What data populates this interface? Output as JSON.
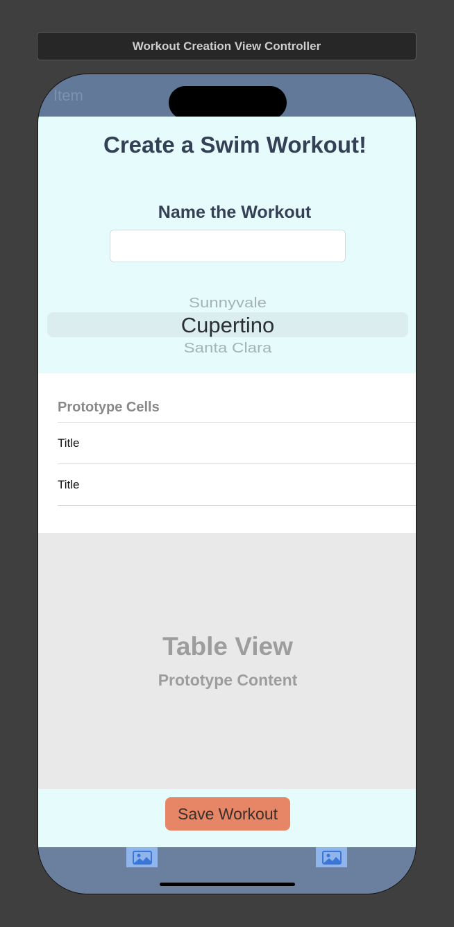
{
  "scene": {
    "title": "Workout Creation View Controller"
  },
  "nav": {
    "item_label": "Item"
  },
  "header": {
    "title": "Create a Swim Workout!"
  },
  "workout_name": {
    "label": "Name the Workout",
    "value": "",
    "placeholder": ""
  },
  "picker": {
    "rows": [
      "Sunnyvale",
      "Cupertino",
      "Santa Clara"
    ],
    "selected": "Cupertino"
  },
  "table": {
    "header": "Prototype Cells",
    "rows": [
      {
        "title": "Title"
      },
      {
        "title": "Title"
      }
    ]
  },
  "placeholder": {
    "title": "Table View",
    "subtitle": "Prototype Content"
  },
  "actions": {
    "save_label": "Save Workout"
  },
  "tab_bar": {
    "items": [
      {
        "icon": "photo-icon"
      },
      {
        "icon": "photo-icon"
      }
    ]
  },
  "colors": {
    "background_canvas": "#3f3f3f",
    "nav_bar": "#62799a",
    "top_panel": "#e6fbfc",
    "title_text": "#344055",
    "save_button": "#e68667",
    "tab_icon": "#8fb5ec",
    "placeholder_bg": "#e9e9e9"
  }
}
